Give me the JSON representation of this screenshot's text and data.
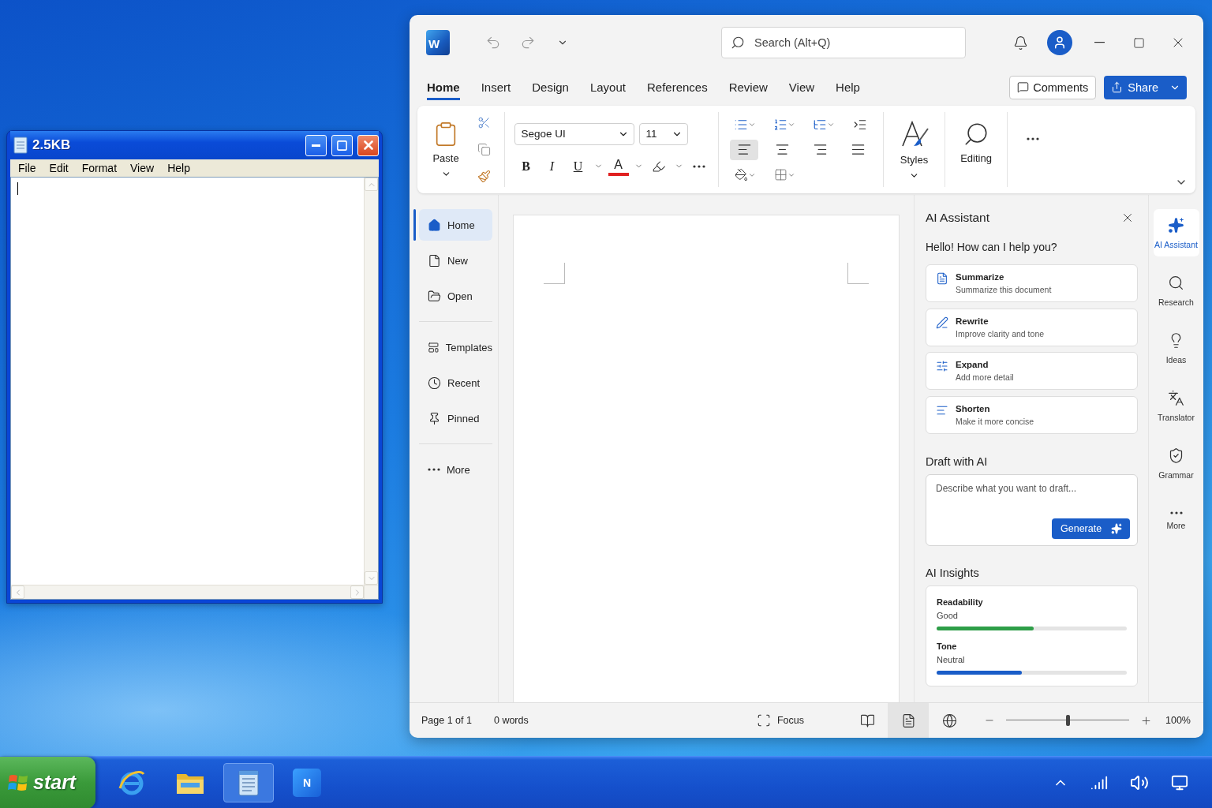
{
  "notepad": {
    "title": "2.5KB",
    "menu": [
      "File",
      "Edit",
      "Format",
      "View",
      "Help"
    ]
  },
  "word": {
    "logo_letter": "W",
    "search": {
      "placeholder": "Search (Alt+Q)"
    },
    "tabs": [
      {
        "label": "Home",
        "selected": true
      },
      {
        "label": "Insert",
        "selected": false
      },
      {
        "label": "Design",
        "selected": false
      },
      {
        "label": "Layout",
        "selected": false
      },
      {
        "label": "References",
        "selected": false
      },
      {
        "label": "Review",
        "selected": false
      },
      {
        "label": "View",
        "selected": false
      },
      {
        "label": "Help",
        "selected": false
      }
    ],
    "comments": "Comments",
    "share": "Share",
    "ribbon": {
      "paste": "Paste",
      "font": "Segoe UI",
      "size": "11",
      "format": [
        {
          "kind": "bold",
          "label": "B"
        },
        {
          "kind": "italic",
          "label": "I"
        },
        {
          "kind": "underline",
          "label": "U"
        },
        {
          "kind": "color",
          "label": "A"
        }
      ],
      "align": [
        {
          "kind": "left",
          "selected": true
        },
        {
          "kind": "center",
          "selected": false
        },
        {
          "kind": "right",
          "selected": false
        },
        {
          "kind": "justify",
          "selected": false
        }
      ],
      "styles": "Styles",
      "editing": "Editing"
    },
    "nav": [
      [
        {
          "kind": "home",
          "label": "Home",
          "selected": true
        },
        {
          "kind": "new",
          "label": "New",
          "selected": false
        },
        {
          "kind": "open",
          "label": "Open",
          "selected": false
        }
      ],
      [
        {
          "kind": "templates",
          "label": "Templates",
          "selected": false
        },
        {
          "kind": "recent",
          "label": "Recent",
          "selected": false
        },
        {
          "kind": "pinned",
          "label": "Pinned",
          "selected": false
        }
      ],
      [
        {
          "kind": "more",
          "label": "More",
          "selected": false
        }
      ]
    ],
    "assistant": {
      "title": "AI Assistant",
      "greeting": "Hello! How can I help you?",
      "actions": [
        {
          "kind": "summarize",
          "title": "Summarize",
          "subtitle": "Summarize this document"
        },
        {
          "kind": "rewrite",
          "title": "Rewrite",
          "subtitle": "Improve clarity and tone"
        },
        {
          "kind": "expand",
          "title": "Expand",
          "subtitle": "Add more detail"
        },
        {
          "kind": "shorten",
          "title": "Shorten",
          "subtitle": "Make it more concise"
        }
      ],
      "draft": {
        "heading": "Draft with AI",
        "placeholder": "Describe what you want to draft...",
        "button": "Generate"
      },
      "insights": {
        "heading": "AI Insights",
        "metrics": [
          {
            "name": "Readability",
            "value": "Good",
            "level": 0.51,
            "color": "#2e9e48"
          },
          {
            "name": "Tone",
            "value": "Neutral",
            "level": 0.45,
            "color": "#1a5dc8"
          }
        ]
      }
    },
    "rail": [
      {
        "kind": "assistant",
        "label": "AI Assistant",
        "selected": true
      },
      {
        "kind": "research",
        "label": "Research",
        "selected": false
      },
      {
        "kind": "ideas",
        "label": "Ideas",
        "selected": false
      },
      {
        "kind": "translator",
        "label": "Translator",
        "selected": false
      },
      {
        "kind": "grammar",
        "label": "Grammar",
        "selected": false
      },
      {
        "kind": "more",
        "label": "More",
        "selected": false
      }
    ],
    "status": {
      "page": "Page 1 of 1",
      "words": "0 words",
      "focus": "Focus",
      "views": [
        {
          "kind": "read",
          "selected": false
        },
        {
          "kind": "print",
          "selected": true
        },
        {
          "kind": "web",
          "selected": false
        }
      ],
      "zoom": {
        "level": 0.5,
        "reading": "100%"
      }
    }
  },
  "taskbar": {
    "start": "start",
    "apps": [
      {
        "kind": "browser",
        "selected": false
      },
      {
        "kind": "folder",
        "selected": false
      },
      {
        "kind": "notepad",
        "selected": true
      },
      {
        "kind": "word",
        "selected": false,
        "letter": "N"
      }
    ]
  }
}
